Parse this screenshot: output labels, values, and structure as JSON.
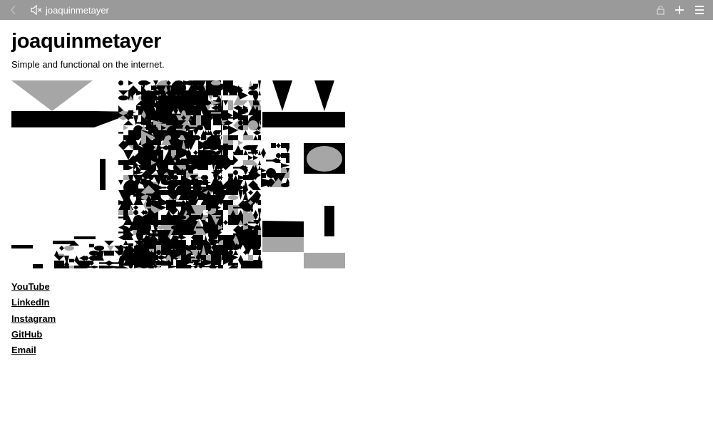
{
  "browser": {
    "tab_title": "joaquinmetayer",
    "icons": [
      "back-icon",
      "speaker-muted-icon",
      "lock-icon",
      "plus-icon",
      "menu-icon"
    ]
  },
  "page": {
    "heading": "joaquinmetayer",
    "tagline": "Simple and functional on the internet."
  },
  "links": [
    {
      "label": "YouTube"
    },
    {
      "label": "LinkedIn"
    },
    {
      "label": "Instagram"
    },
    {
      "label": "GitHub"
    },
    {
      "label": "Email"
    }
  ],
  "colors": {
    "toolbar_bg": "#9a9a9a",
    "toolbar_text": "#ffffff",
    "page_bg": "#ffffff",
    "text": "#000000",
    "art_grey": "#a6a6a6"
  }
}
